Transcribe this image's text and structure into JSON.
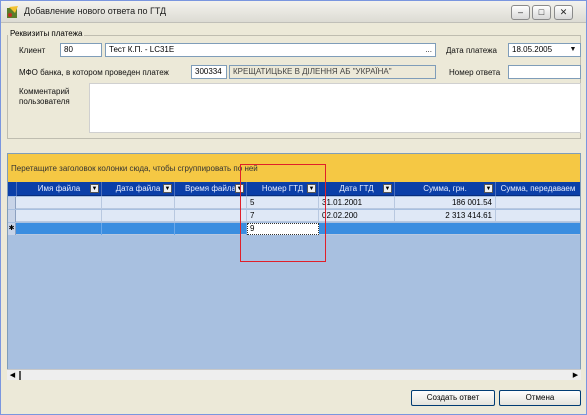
{
  "window": {
    "title": "Добавление нового ответа по ГТД",
    "min_glyph": "–",
    "max_glyph": "□",
    "close_glyph": "✕"
  },
  "payment": {
    "group_title": "Реквизиты платежа",
    "client_label": "Клиент",
    "client_code": "80",
    "client_name": "Тест К.П. - LC31E",
    "client_dots": "...",
    "payment_date_label": "Дата платежа",
    "payment_date": "18.05.2005",
    "bank_label": "МФО банка, в котором проведен платеж",
    "bank_mfo": "300334",
    "bank_name": "КРЕЩАТИЦЬКЕ В ДІЛЕННЯ АБ \"УКРАЇНА\"",
    "answer_number_label": "Номер ответа",
    "answer_number": "",
    "comment_label": "Комментарий пользователя",
    "comment": ""
  },
  "grid": {
    "group_panel_text": "Перетащите заголовок колонки сюда, чтобы сгруппировать по ней",
    "columns": [
      "Имя файла",
      "Дата файла",
      "Время файла",
      "Номер ГТД",
      "Дата ГТД",
      "Сумма, грн.",
      "Сумма, передаваем"
    ],
    "rows": [
      [
        "",
        "",
        "",
        "5",
        "31.01.2001",
        "186 001.54",
        ""
      ],
      [
        "",
        "",
        "",
        "7",
        "02.02.200",
        "2 313 414.61",
        ""
      ]
    ],
    "new_row": {
      "indicator": "✱",
      "edit_value": "9"
    }
  },
  "buttons": {
    "create": "Создать ответ",
    "cancel": "Отмена"
  },
  "colors": {
    "group_panel": "#f5c844",
    "header": "#0b3fa8",
    "grid_bg": "#a8c0e0",
    "highlight": "#e0202a"
  }
}
